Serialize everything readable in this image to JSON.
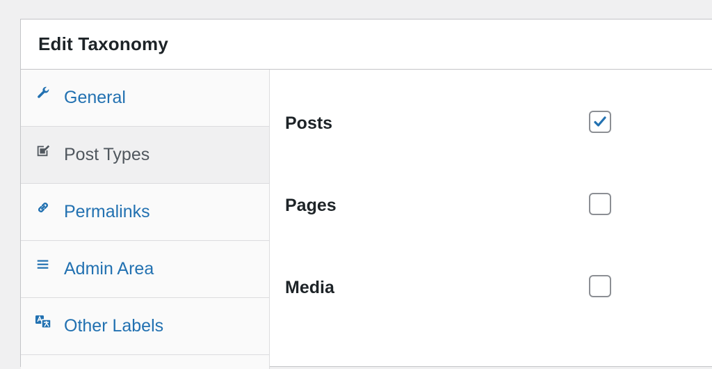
{
  "panel": {
    "title": "Edit Taxonomy"
  },
  "tabs": [
    {
      "label": "General",
      "icon": "wrench-icon",
      "active": false
    },
    {
      "label": "Post Types",
      "icon": "edit-page-icon",
      "active": true
    },
    {
      "label": "Permalinks",
      "icon": "link-icon",
      "active": false
    },
    {
      "label": "Admin Area",
      "icon": "menu-icon",
      "active": false
    },
    {
      "label": "Other Labels",
      "icon": "translation-icon",
      "active": false
    }
  ],
  "post_types": [
    {
      "label": "Posts",
      "checked": true
    },
    {
      "label": "Pages",
      "checked": false
    },
    {
      "label": "Media",
      "checked": false
    }
  ],
  "colors": {
    "link": "#2271b1",
    "active_text": "#50575e",
    "check": "#2271b1"
  }
}
